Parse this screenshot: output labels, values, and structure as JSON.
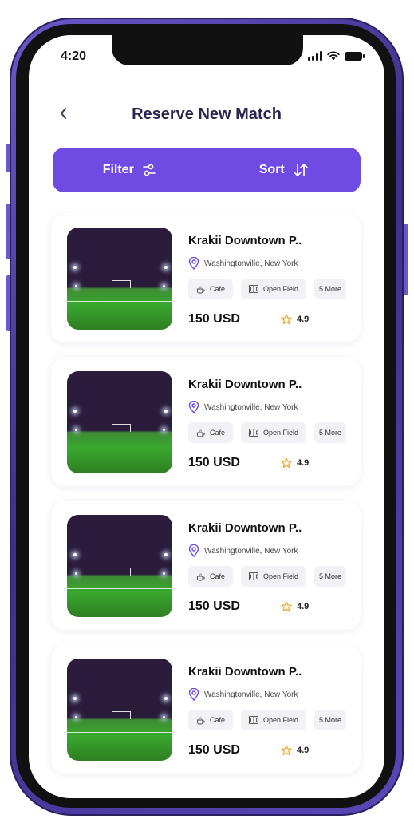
{
  "status_bar": {
    "time": "4:20"
  },
  "header": {
    "back_icon": "chevron-left-icon",
    "title": "Reserve New Match"
  },
  "filter_sort": {
    "filter_label": "Filter",
    "filter_icon": "sliders-icon",
    "sort_label": "Sort",
    "sort_icon": "sort-arrows-icon"
  },
  "colors": {
    "accent": "#6f4ae3",
    "title": "#2a2650",
    "star": "#f2a516"
  },
  "venues": [
    {
      "name": "Krakii Downtown P..",
      "location": "Washingtonville, New York",
      "amenities": [
        "Cafe",
        "Open Field"
      ],
      "more": "5 More",
      "price": "150 USD",
      "rating": "4.9"
    },
    {
      "name": "Krakii Downtown P..",
      "location": "Washingtonville, New York",
      "amenities": [
        "Cafe",
        "Open Field"
      ],
      "more": "5 More",
      "price": "150 USD",
      "rating": "4.9"
    },
    {
      "name": "Krakii Downtown P..",
      "location": "Washingtonville, New York",
      "amenities": [
        "Cafe",
        "Open Field"
      ],
      "more": "5 More",
      "price": "150 USD",
      "rating": "4.9"
    },
    {
      "name": "Krakii Downtown P..",
      "location": "Washingtonville, New York",
      "amenities": [
        "Cafe",
        "Open Field"
      ],
      "more": "5 More",
      "price": "150 USD",
      "rating": "4.9"
    }
  ]
}
